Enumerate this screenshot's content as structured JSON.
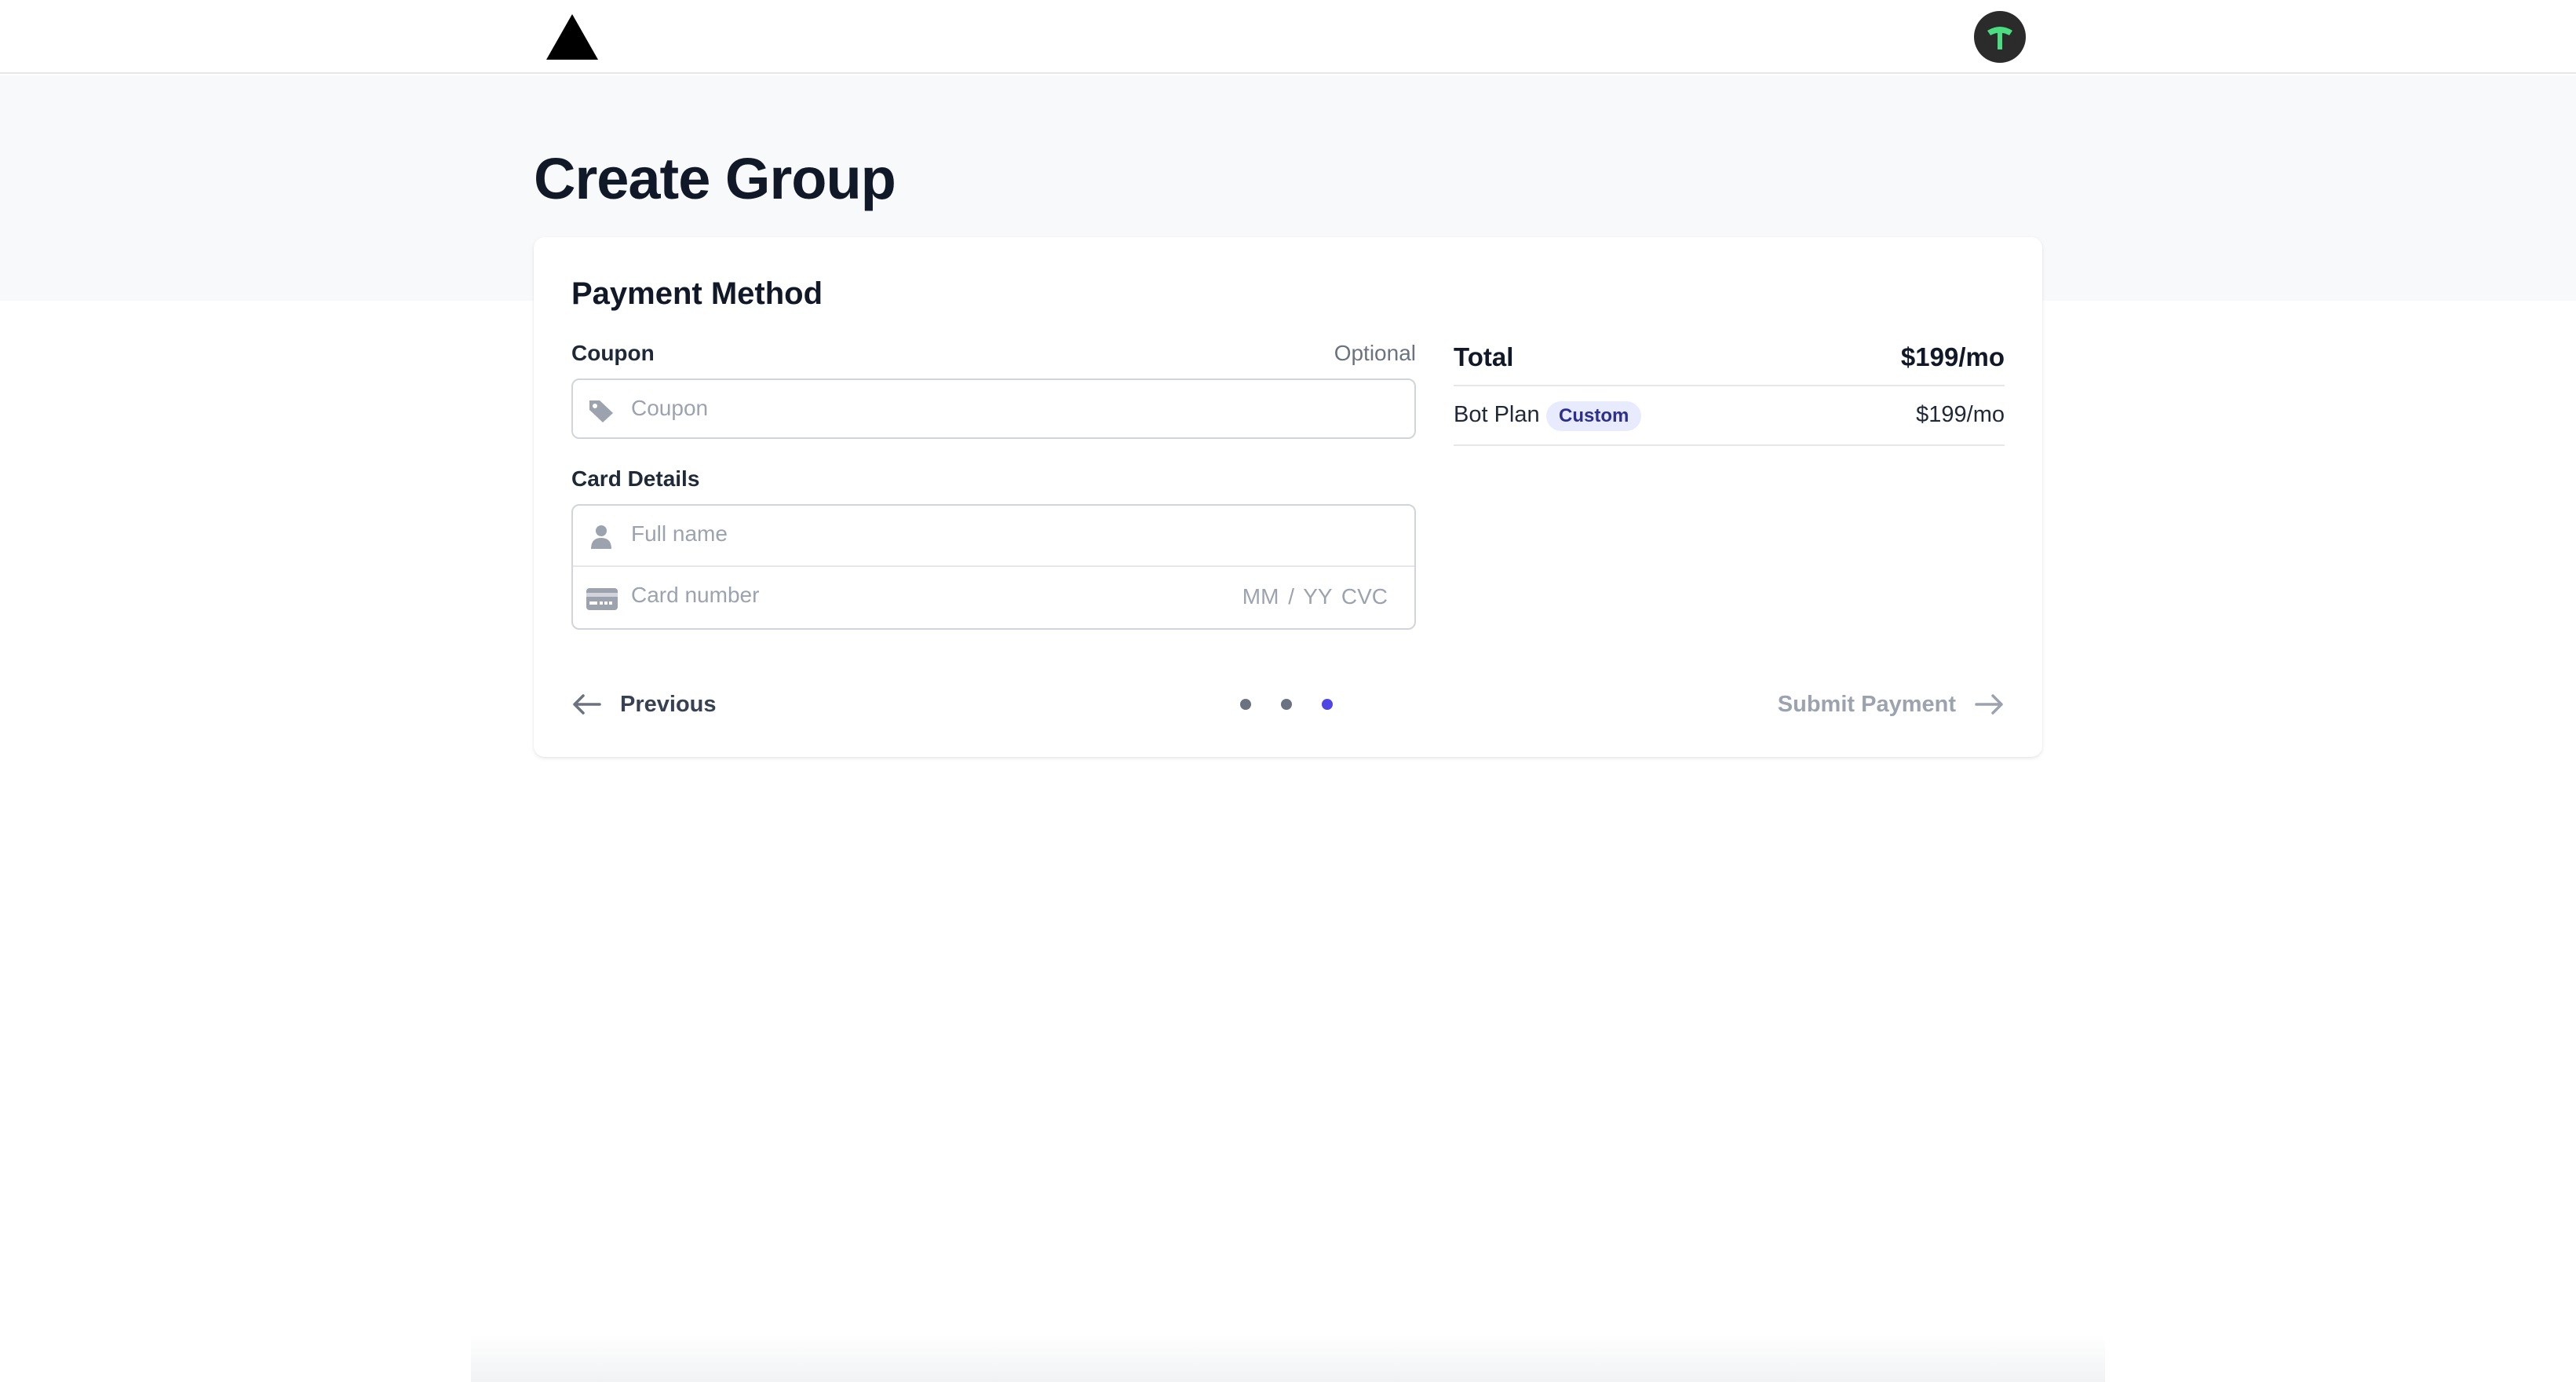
{
  "header": {
    "logo_icon": "triangle-logo-icon",
    "avatar_initial_icon": "t-letter-avatar-icon",
    "avatar_color": "#2b2b2b",
    "avatar_glyph_color": "#4ade80"
  },
  "page": {
    "title": "Create Group"
  },
  "payment": {
    "title": "Payment Method",
    "coupon": {
      "label": "Coupon",
      "hint": "Optional",
      "placeholder": "Coupon",
      "icon": "tag-icon"
    },
    "card_details": {
      "label": "Card Details",
      "name_placeholder": "Full name",
      "name_icon": "user-icon",
      "number_placeholder": "Card number",
      "number_icon": "credit-card-icon",
      "expiry_cvc_placeholder": "MM / YY  CVC"
    }
  },
  "summary": {
    "total_label": "Total",
    "total_value": "$199/mo",
    "items": [
      {
        "name": "Bot Plan",
        "badge": "Custom",
        "price": "$199/mo"
      }
    ]
  },
  "footer": {
    "previous_label": "Previous",
    "previous_icon": "arrow-left-icon",
    "next_label": "Submit Payment",
    "next_icon": "arrow-right-icon",
    "steps_total": 3,
    "current_step": 3,
    "accent_color": "#4f46e5"
  }
}
